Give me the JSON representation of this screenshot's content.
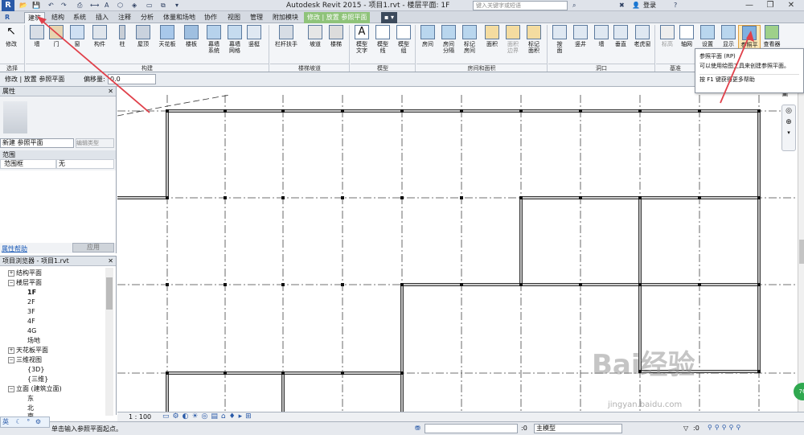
{
  "titlebar": {
    "logo": "R",
    "window_title": "Autodesk Revit 2015 -   项目1.rvt - 楼层平面: 1F",
    "search_placeholder": "键入关键字或短语",
    "login": "登录",
    "min": "—",
    "restore": "❐",
    "close": "✕"
  },
  "tabs": [
    "建筑",
    "结构",
    "系统",
    "插入",
    "注释",
    "分析",
    "体量和场地",
    "协作",
    "视图",
    "管理",
    "附加模块",
    "修改 | 放置 参照平面"
  ],
  "ribbon": {
    "buttons": [
      {
        "label": "修改"
      },
      {
        "label": "墙"
      },
      {
        "label": "门"
      },
      {
        "label": "窗"
      },
      {
        "label": "构件"
      },
      {
        "label": "柱"
      },
      {
        "label": "屋顶"
      },
      {
        "label": "天花板"
      },
      {
        "label": "楼板"
      },
      {
        "label": "幕墙\n系统"
      },
      {
        "label": "幕墙\n网格"
      },
      {
        "label": "竖梃"
      },
      {
        "label": "栏杆扶手"
      },
      {
        "label": "坡道"
      },
      {
        "label": "楼梯"
      },
      {
        "label": "模型\n文字"
      },
      {
        "label": "模型\n线"
      },
      {
        "label": "模型\n组"
      },
      {
        "label": "房间"
      },
      {
        "label": "房间\n分隔"
      },
      {
        "label": "标记\n房间"
      },
      {
        "label": "面积"
      },
      {
        "label": "面积\n边界"
      },
      {
        "label": "标记\n面积"
      },
      {
        "label": "按\n面"
      },
      {
        "label": "竖井"
      },
      {
        "label": "墙"
      },
      {
        "label": "垂直"
      },
      {
        "label": "老虎窗"
      },
      {
        "label": "标高"
      },
      {
        "label": "轴网"
      },
      {
        "label": "设置"
      },
      {
        "label": "显示"
      },
      {
        "label": "参照平面"
      },
      {
        "label": "查看器"
      }
    ],
    "panels": [
      "选择",
      "构建",
      "楼梯坡道",
      "模型",
      "房间和面积",
      "洞口",
      "基准"
    ]
  },
  "tooltip": {
    "title": "参照平面 (RP)",
    "desc": "可以使用绘图工具来创建参照平面。",
    "help": "按 F1 键获得更多帮助"
  },
  "optionsbar": {
    "context": "修改 | 放置 参照平面",
    "offset_label": "偏移量:",
    "offset_value": "0.0"
  },
  "properties": {
    "title": "属性",
    "type_selector": "新建 参照平面",
    "edit_type": "编辑类型",
    "section": "范围",
    "row_label": "范围框",
    "row_value": "无",
    "help_link": "属性帮助",
    "apply": "应用"
  },
  "browser": {
    "title": "项目浏览器 - 项目1.rvt",
    "items": [
      {
        "text": "结构平面",
        "toggle": "+"
      },
      {
        "text": "楼层平面",
        "toggle": "−"
      },
      {
        "text": "1F"
      },
      {
        "text": "2F"
      },
      {
        "text": "3F"
      },
      {
        "text": "4F"
      },
      {
        "text": "4G"
      },
      {
        "text": "场地"
      },
      {
        "text": "天花板平面",
        "toggle": "+"
      },
      {
        "text": "三维视图",
        "toggle": "−"
      },
      {
        "text": "{3D}"
      },
      {
        "text": "{三维}"
      },
      {
        "text": "立面 (建筑立面)",
        "toggle": "−"
      },
      {
        "text": "东"
      },
      {
        "text": "北"
      },
      {
        "text": "南"
      }
    ]
  },
  "viewbar": {
    "scale": "1 : 100"
  },
  "statusbar": {
    "message": "单击输入参照平面起点。",
    "coord1": ":0",
    "workset": "主模型",
    "coord2": ":0"
  },
  "ime": {
    "text": "英"
  },
  "watermark": {
    "text": "Bai经验",
    "sub": "jingyan.baidu.com"
  },
  "badge": "76",
  "colors": {
    "arrow": "#e0404a",
    "context_tab": "#8fc37a",
    "accent": "#2a5aa8"
  }
}
